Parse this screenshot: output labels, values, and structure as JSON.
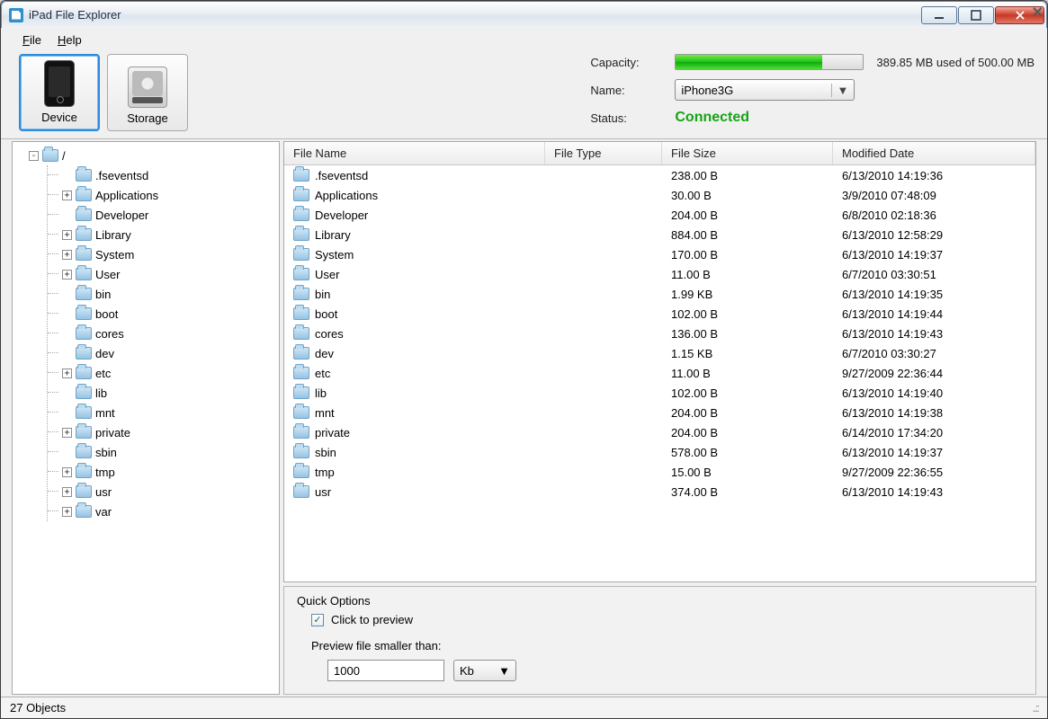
{
  "title": "iPad File Explorer",
  "menu": {
    "file": "File",
    "help": "Help"
  },
  "toolbar": {
    "device": "Device",
    "storage": "Storage"
  },
  "info": {
    "capacity_label": "Capacity:",
    "capacity_text": "389.85 MB used of 500.00 MB",
    "capacity_pct": 78,
    "name_label": "Name:",
    "name_value": "iPhone3G",
    "status_label": "Status:",
    "status_value": "Connected"
  },
  "tree": {
    "root": "/",
    "items": [
      {
        "name": ".fseventsd",
        "exp": ""
      },
      {
        "name": "Applications",
        "exp": "+"
      },
      {
        "name": "Developer",
        "exp": ""
      },
      {
        "name": "Library",
        "exp": "+"
      },
      {
        "name": "System",
        "exp": "+"
      },
      {
        "name": "User",
        "exp": "+"
      },
      {
        "name": "bin",
        "exp": ""
      },
      {
        "name": "boot",
        "exp": ""
      },
      {
        "name": "cores",
        "exp": ""
      },
      {
        "name": "dev",
        "exp": ""
      },
      {
        "name": "etc",
        "exp": "+"
      },
      {
        "name": "lib",
        "exp": ""
      },
      {
        "name": "mnt",
        "exp": ""
      },
      {
        "name": "private",
        "exp": "+"
      },
      {
        "name": "sbin",
        "exp": ""
      },
      {
        "name": "tmp",
        "exp": "+"
      },
      {
        "name": "usr",
        "exp": "+"
      },
      {
        "name": "var",
        "exp": "+"
      }
    ]
  },
  "columns": {
    "name": "File Name",
    "type": "File Type",
    "size": "File Size",
    "date": "Modified Date"
  },
  "files": [
    {
      "name": ".fseventsd",
      "type": "",
      "size": "238.00 B",
      "date": "6/13/2010 14:19:36"
    },
    {
      "name": "Applications",
      "type": "",
      "size": "30.00 B",
      "date": "3/9/2010 07:48:09"
    },
    {
      "name": "Developer",
      "type": "",
      "size": "204.00 B",
      "date": "6/8/2010 02:18:36"
    },
    {
      "name": "Library",
      "type": "",
      "size": "884.00 B",
      "date": "6/13/2010 12:58:29"
    },
    {
      "name": "System",
      "type": "",
      "size": "170.00 B",
      "date": "6/13/2010 14:19:37"
    },
    {
      "name": "User",
      "type": "",
      "size": "11.00 B",
      "date": "6/7/2010 03:30:51"
    },
    {
      "name": "bin",
      "type": "",
      "size": "1.99 KB",
      "date": "6/13/2010 14:19:35"
    },
    {
      "name": "boot",
      "type": "",
      "size": "102.00 B",
      "date": "6/13/2010 14:19:44"
    },
    {
      "name": "cores",
      "type": "",
      "size": "136.00 B",
      "date": "6/13/2010 14:19:43"
    },
    {
      "name": "dev",
      "type": "",
      "size": "1.15 KB",
      "date": "6/7/2010 03:30:27"
    },
    {
      "name": "etc",
      "type": "",
      "size": "11.00 B",
      "date": "9/27/2009 22:36:44"
    },
    {
      "name": "lib",
      "type": "",
      "size": "102.00 B",
      "date": "6/13/2010 14:19:40"
    },
    {
      "name": "mnt",
      "type": "",
      "size": "204.00 B",
      "date": "6/13/2010 14:19:38"
    },
    {
      "name": "private",
      "type": "",
      "size": "204.00 B",
      "date": "6/14/2010 17:34:20"
    },
    {
      "name": "sbin",
      "type": "",
      "size": "578.00 B",
      "date": "6/13/2010 14:19:37"
    },
    {
      "name": "tmp",
      "type": "",
      "size": "15.00 B",
      "date": "9/27/2009 22:36:55"
    },
    {
      "name": "usr",
      "type": "",
      "size": "374.00 B",
      "date": "6/13/2010 14:19:43"
    }
  ],
  "quick": {
    "title": "Quick Options",
    "preview_chk": "Click to preview",
    "preview_chk_on": true,
    "prev_smaller": "Preview file smaller than:",
    "prev_value": "1000",
    "prev_unit": "Kb"
  },
  "status": {
    "objects": "27 Objects"
  }
}
